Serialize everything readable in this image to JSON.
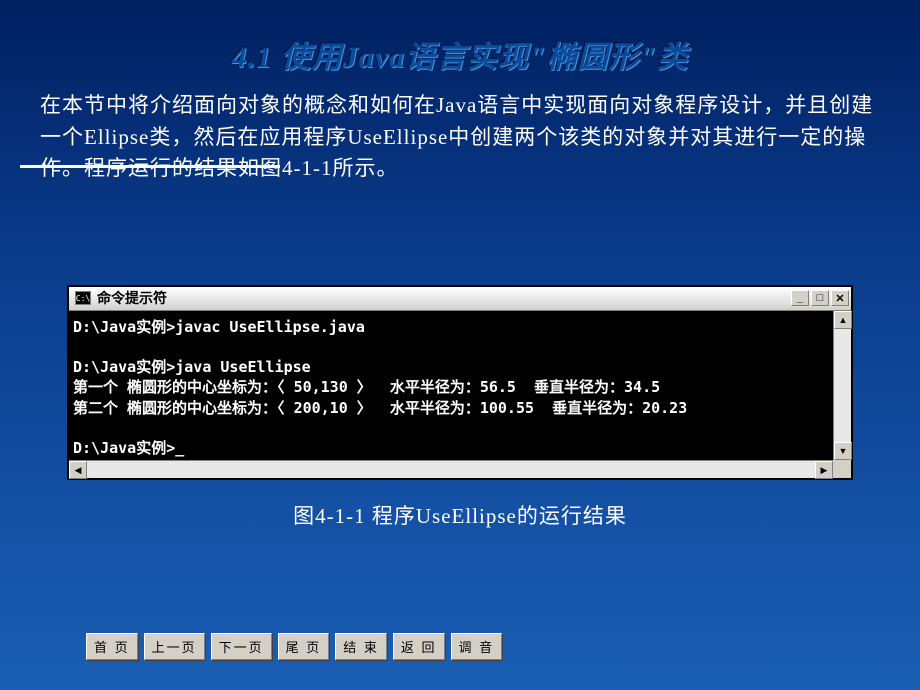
{
  "title": "4.1  使用Java语言实现\"椭圆形\"类",
  "intro": "在本节中将介绍面向对象的概念和如何在Java语言中实现面向对象程序设计，并且创建一个Ellipse类，然后在应用程序UseEllipse中创建两个该类的对象并对其进行一定的操作。程序运行的结果如图4-1-1所示。",
  "console": {
    "icon": "C:\\",
    "title": "命令提示符",
    "lines": [
      "D:\\Java实例>javac UseEllipse.java",
      "",
      "D:\\Java实例>java UseEllipse",
      "第一个 椭圆形的中心坐标为：〈 50,130 〉  水平半径为：56.5  垂直半径为：34.5",
      "第二个 椭圆形的中心坐标为：〈 200,10 〉  水平半径为：100.55  垂直半径为：20.23",
      "",
      "D:\\Java实例>_"
    ]
  },
  "caption": "图4-1-1  程序UseEllipse的运行结果",
  "nav": {
    "home": "首 页",
    "prev": "上一页",
    "next": "下一页",
    "last": "尾 页",
    "end": "结 束",
    "back": "返 回",
    "sound": "调 音"
  }
}
